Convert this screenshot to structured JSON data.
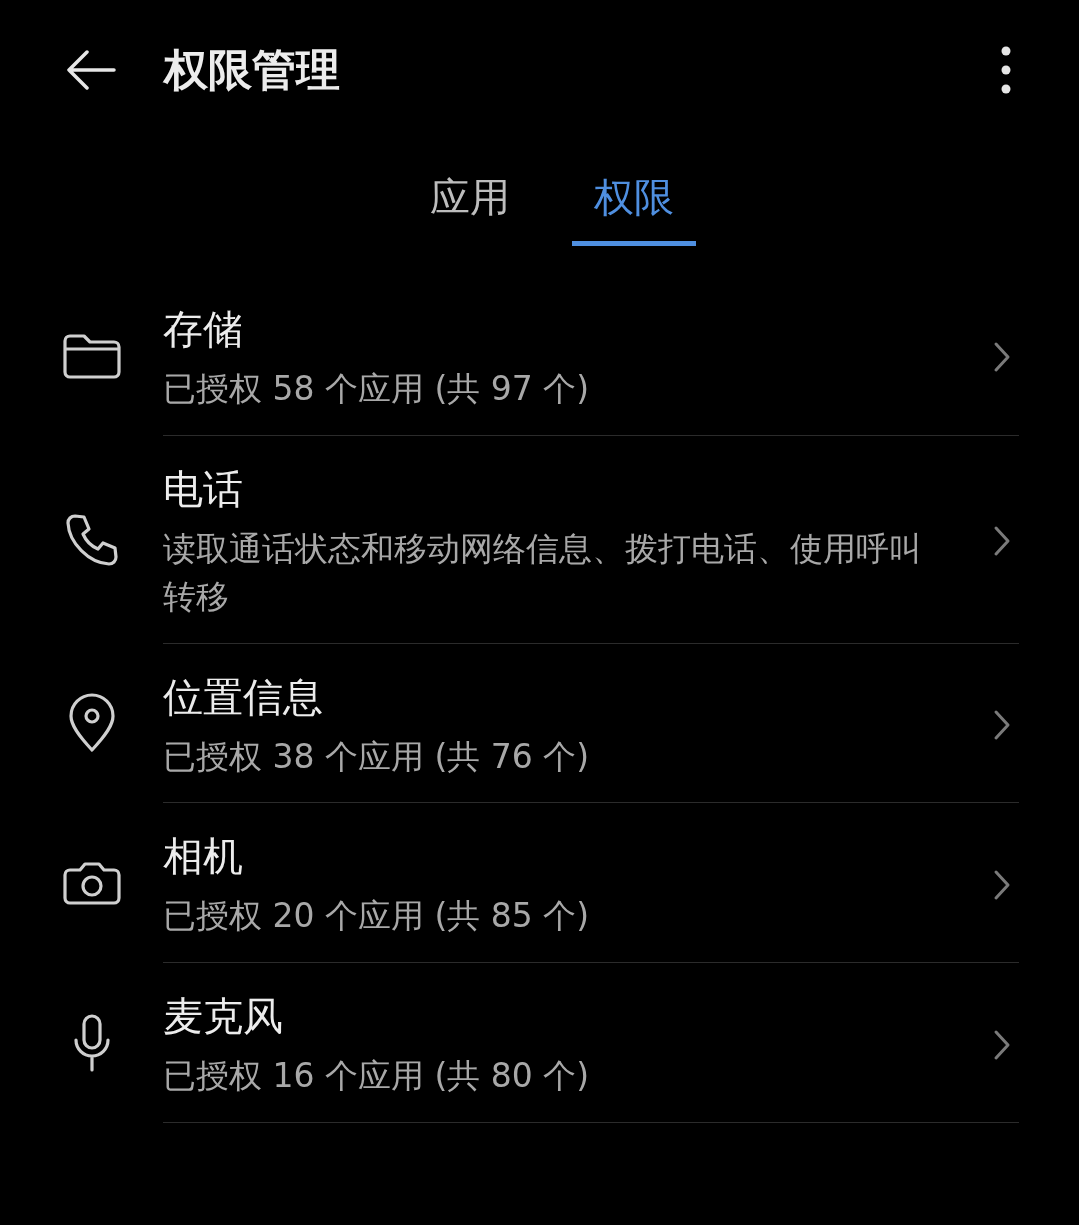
{
  "header": {
    "title": "权限管理"
  },
  "tabs": [
    {
      "label": "应用",
      "selected": false
    },
    {
      "label": "权限",
      "selected": true
    }
  ],
  "permissions": [
    {
      "kind": "folder",
      "title": "存储",
      "subtitle": "已授权 58 个应用 (共 97 个)"
    },
    {
      "kind": "phone",
      "title": "电话",
      "subtitle": "读取通话状态和移动网络信息、拨打电话、使用呼叫转移"
    },
    {
      "kind": "pin",
      "title": "位置信息",
      "subtitle": "已授权 38 个应用 (共 76 个)"
    },
    {
      "kind": "camera",
      "title": "相机",
      "subtitle": "已授权 20 个应用 (共 85 个)"
    },
    {
      "kind": "mic",
      "title": "麦克风",
      "subtitle": "已授权 16 个应用 (共 80 个)"
    }
  ]
}
